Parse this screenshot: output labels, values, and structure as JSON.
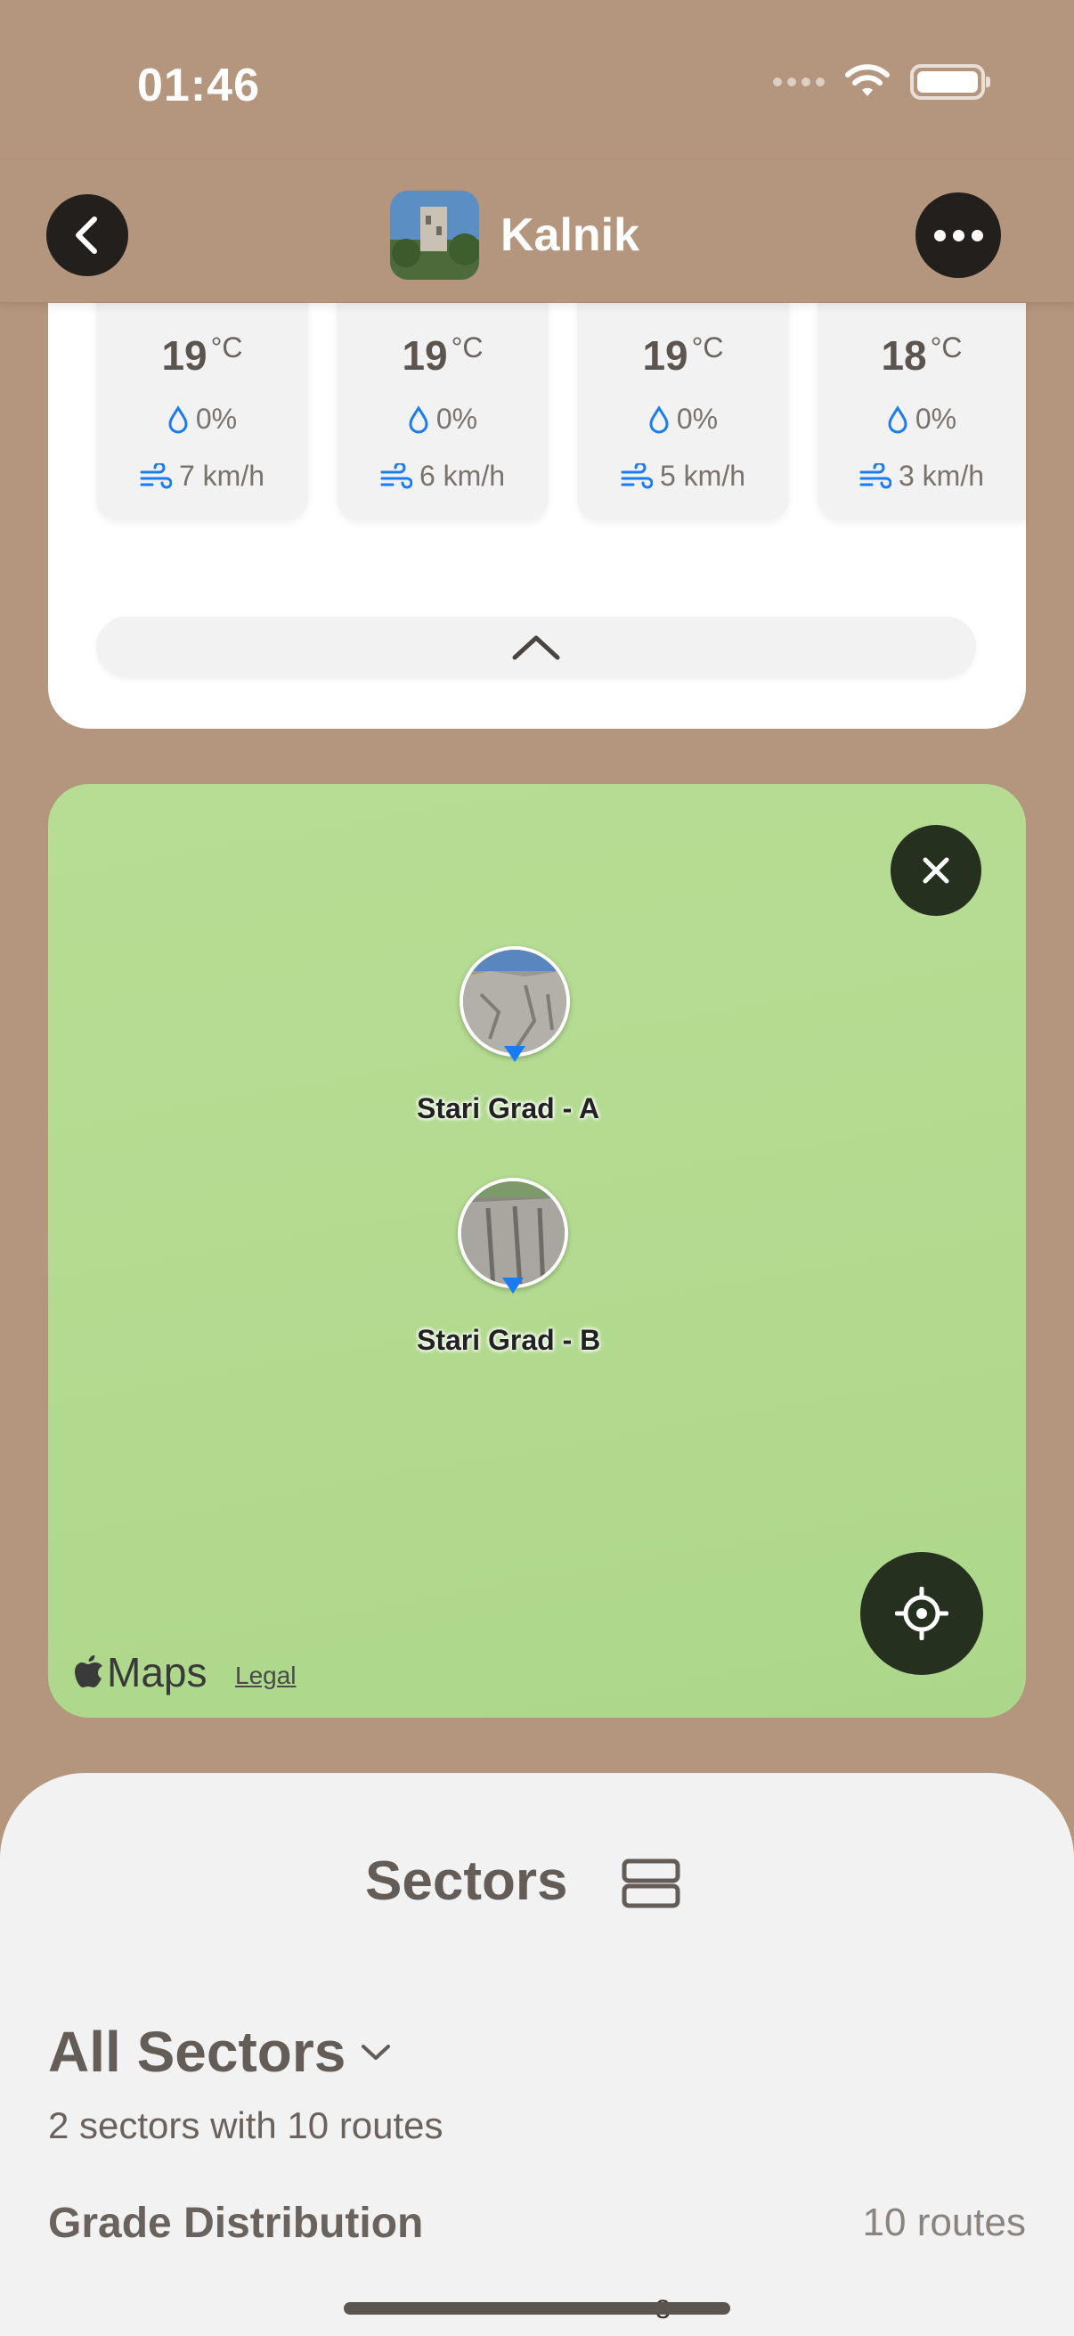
{
  "status_bar": {
    "time": "01:46"
  },
  "header": {
    "title": "Kalnik"
  },
  "weather": {
    "hours": [
      {
        "temp": "19",
        "unit": "°C",
        "rain": "0%",
        "wind": "7 km/h"
      },
      {
        "temp": "19",
        "unit": "°C",
        "rain": "0%",
        "wind": "6 km/h"
      },
      {
        "temp": "19",
        "unit": "°C",
        "rain": "0%",
        "wind": "5 km/h"
      },
      {
        "temp": "18",
        "unit": "°C",
        "rain": "0%",
        "wind": "3 km/h"
      }
    ]
  },
  "map": {
    "pins": [
      {
        "label": "Stari Grad - A"
      },
      {
        "label": "Stari Grad - B"
      }
    ],
    "brand": "Maps",
    "legal": "Legal"
  },
  "sheet": {
    "title": "Sectors",
    "filter": "All Sectors",
    "subtitle": "2 sectors with 10 routes",
    "section_title": "Grade Distribution",
    "section_count": "10 routes",
    "page_number": "3"
  },
  "colors": {
    "background": "#b4957d",
    "map_green": "#b4db91",
    "dark_button": "#231f1c",
    "pin_blue": "#1a7cf0"
  }
}
